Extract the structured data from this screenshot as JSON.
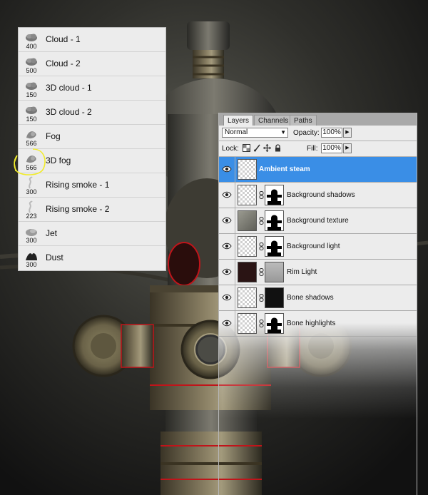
{
  "brush_presets": [
    {
      "name": "Cloud - 1",
      "size": "400",
      "icon": "cloud-brush-icon"
    },
    {
      "name": "Cloud - 2",
      "size": "500",
      "icon": "cloud-brush-icon"
    },
    {
      "name": "3D cloud - 1",
      "size": "150",
      "icon": "cloud-brush-icon"
    },
    {
      "name": "3D cloud - 2",
      "size": "150",
      "icon": "cloud-brush-icon"
    },
    {
      "name": "Fog",
      "size": "566",
      "icon": "fog-brush-icon"
    },
    {
      "name": "3D fog",
      "size": "566",
      "icon": "fog-brush-icon",
      "highlighted": true
    },
    {
      "name": "Rising smoke - 1",
      "size": "300",
      "icon": "smoke-brush-icon"
    },
    {
      "name": "Rising smoke - 2",
      "size": "223",
      "icon": "smoke-brush-icon"
    },
    {
      "name": "Jet",
      "size": "300",
      "icon": "jet-brush-icon"
    },
    {
      "name": "Dust",
      "size": "300",
      "icon": "dust-brush-icon"
    }
  ],
  "layers_panel": {
    "tabs": [
      "Layers",
      "Channels",
      "Paths"
    ],
    "active_tab": "Layers",
    "blend_mode": "Normal",
    "opacity_label": "Opacity:",
    "opacity": "100%",
    "lock_label": "Lock:",
    "fill_label": "Fill:",
    "fill": "100%",
    "layers": [
      {
        "name": "Ambient steam",
        "selected": true,
        "has_mask": false
      },
      {
        "name": "Background shadows",
        "selected": false,
        "has_mask": true
      },
      {
        "name": "Background texture",
        "selected": false,
        "has_mask": true
      },
      {
        "name": "Background light",
        "selected": false,
        "has_mask": true
      },
      {
        "name": "Rim Light",
        "selected": false,
        "has_mask": true
      },
      {
        "name": "Bone shadows",
        "selected": false,
        "has_mask": true
      },
      {
        "name": "Bone highlights",
        "selected": false,
        "has_mask": true
      }
    ]
  },
  "colors": {
    "selection": "#3a8ee6",
    "highlight_circle": "#f2ec2a",
    "rim_red": "#c0141a"
  }
}
